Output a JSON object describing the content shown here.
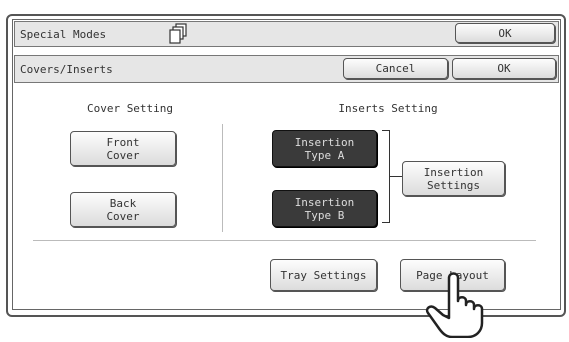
{
  "window": {
    "title": "Special Modes",
    "ok_label": "OK"
  },
  "subheader": {
    "title": "Covers/Inserts",
    "cancel_label": "Cancel",
    "ok_label": "OK"
  },
  "cover_setting": {
    "heading": "Cover Setting",
    "front_cover_label": "Front\nCover",
    "back_cover_label": "Back\nCover"
  },
  "inserts_setting": {
    "heading": "Inserts Setting",
    "insertion_type_a_label": "Insertion\nType A",
    "insertion_type_b_label": "Insertion\nType B",
    "insertion_settings_label": "Insertion\nSettings"
  },
  "footer": {
    "tray_settings_label": "Tray Settings",
    "page_layout_label": "Page Layout"
  },
  "colors": {
    "selected_button": "#3a3a3a",
    "bar_background": "#e6e6e6"
  },
  "icons": {
    "copies_icon": "stacked-pages-icon",
    "pointer_icon": "hand-pointer-icon"
  }
}
